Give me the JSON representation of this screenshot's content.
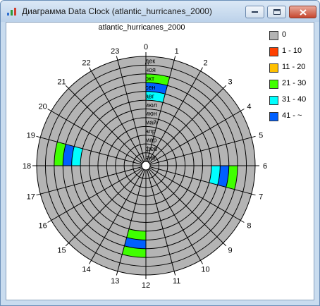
{
  "window": {
    "title": "Диаграмма Data Clock (atlantic_hurricanes_2000)"
  },
  "chart_data": {
    "type": "data-clock",
    "title": "atlantic_hurricanes_2000",
    "hours": [
      "0",
      "1",
      "2",
      "3",
      "4",
      "5",
      "6",
      "7",
      "8",
      "9",
      "10",
      "11",
      "12",
      "13",
      "14",
      "15",
      "16",
      "17",
      "18",
      "19",
      "20",
      "21",
      "22",
      "23"
    ],
    "months": [
      "дек",
      "ноя",
      "окт",
      "сен",
      "авг",
      "июл",
      "июн",
      "май",
      "апр",
      "мар",
      "фев",
      "янв"
    ],
    "legend": [
      {
        "label": "0",
        "color": "#b4b4b4"
      },
      {
        "label": "1 - 10",
        "color": "#ff4000"
      },
      {
        "label": "11 - 20",
        "color": "#ffc000"
      },
      {
        "label": "21 - 30",
        "color": "#40ff00"
      },
      {
        "label": "31 - 40",
        "color": "#00ffff"
      },
      {
        "label": "41 - ~",
        "color": "#0060ff"
      }
    ],
    "cells": [
      {
        "hour": 0,
        "month": "окт",
        "bin": "21 - 30"
      },
      {
        "hour": 0,
        "month": "сен",
        "bin": "41 - ~"
      },
      {
        "hour": 0,
        "month": "авг",
        "bin": "31 - 40"
      },
      {
        "hour": 6,
        "month": "окт",
        "bin": "21 - 30"
      },
      {
        "hour": 6,
        "month": "сен",
        "bin": "41 - ~"
      },
      {
        "hour": 6,
        "month": "авг",
        "bin": "31 - 40"
      },
      {
        "hour": 12,
        "month": "окт",
        "bin": "21 - 30"
      },
      {
        "hour": 12,
        "month": "сен",
        "bin": "41 - ~"
      },
      {
        "hour": 12,
        "month": "авг",
        "bin": "21 - 30"
      },
      {
        "hour": 18,
        "month": "окт",
        "bin": "21 - 30"
      },
      {
        "hour": 18,
        "month": "сен",
        "bin": "41 - ~"
      },
      {
        "hour": 18,
        "month": "авг",
        "bin": "31 - 40"
      }
    ]
  }
}
